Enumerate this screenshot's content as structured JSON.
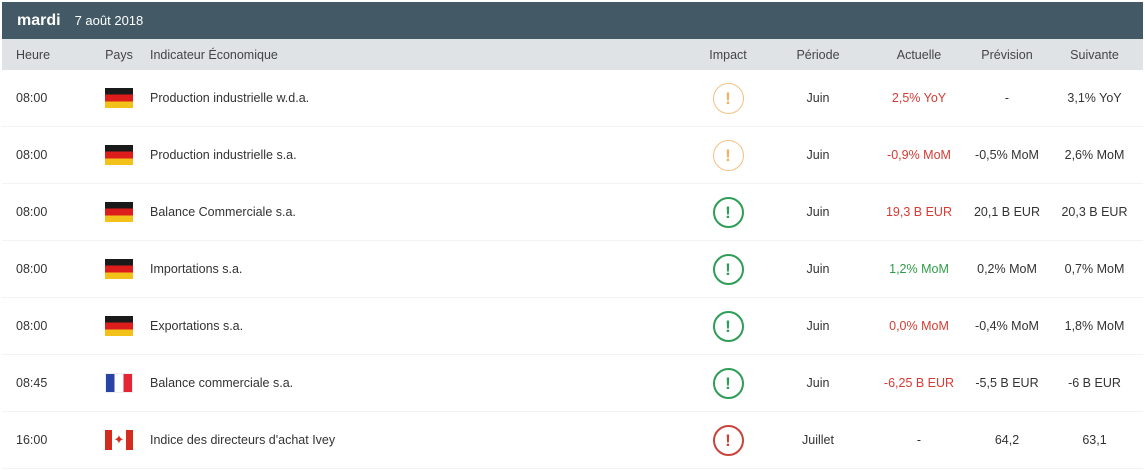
{
  "header": {
    "day": "mardi",
    "date": "7 août 2018"
  },
  "columns": {
    "time": "Heure",
    "country": "Pays",
    "indicator": "Indicateur Économique",
    "impact": "Impact",
    "period": "Période",
    "actual": "Actuelle",
    "forecast": "Prévision",
    "next": "Suivante"
  },
  "rows": [
    {
      "time": "08:00",
      "flag": "germany-flag",
      "indicator": "Production industrielle w.d.a.",
      "impact": "low",
      "impact_symbol": "!",
      "period": "Juin",
      "actual": "2,5% YoY",
      "actual_color": "#d43b34",
      "forecast": "-",
      "next": "3,1% YoY"
    },
    {
      "time": "08:00",
      "flag": "germany-flag",
      "indicator": "Production industrielle s.a.",
      "impact": "low",
      "impact_symbol": "!",
      "period": "Juin",
      "actual": "-0,9% MoM",
      "actual_color": "#d43b34",
      "forecast": "-0,5% MoM",
      "next": "2,6% MoM"
    },
    {
      "time": "08:00",
      "flag": "germany-flag",
      "indicator": "Balance Commerciale s.a.",
      "impact": "medium",
      "impact_symbol": "!",
      "period": "Juin",
      "actual": "19,3 B EUR",
      "actual_color": "#d43b34",
      "forecast": "20,1 B EUR",
      "next": "20,3 B EUR"
    },
    {
      "time": "08:00",
      "flag": "germany-flag",
      "indicator": "Importations s.a.",
      "impact": "medium",
      "impact_symbol": "!",
      "period": "Juin",
      "actual": "1,2% MoM",
      "actual_color": "#2e9e46",
      "forecast": "0,2% MoM",
      "next": "0,7% MoM"
    },
    {
      "time": "08:00",
      "flag": "germany-flag",
      "indicator": "Exportations s.a.",
      "impact": "medium",
      "impact_symbol": "!",
      "period": "Juin",
      "actual": "0,0% MoM",
      "actual_color": "#d43b34",
      "forecast": "-0,4% MoM",
      "next": "1,8% MoM"
    },
    {
      "time": "08:45",
      "flag": "france-flag",
      "indicator": "Balance commerciale s.a.",
      "impact": "medium",
      "impact_symbol": "!",
      "period": "Juin",
      "actual": "-6,25 B EUR",
      "actual_color": "#d43b34",
      "forecast": "-5,5 B EUR",
      "next": "-6 B EUR"
    },
    {
      "time": "16:00",
      "flag": "canada-flag",
      "indicator": "Indice des directeurs d'achat Ivey",
      "impact": "high",
      "impact_symbol": "!",
      "period": "Juillet",
      "actual": "-",
      "actual_color": "#333333",
      "forecast": "64,2",
      "next": "63,1"
    }
  ],
  "colors": {
    "header_bg": "#435a66",
    "column_header_bg": "#dfe3e6",
    "impact_low": "#f2b15f",
    "impact_medium": "#2e9e57",
    "impact_high": "#c9433b",
    "negative": "#d43b34",
    "positive": "#2e9e46"
  }
}
